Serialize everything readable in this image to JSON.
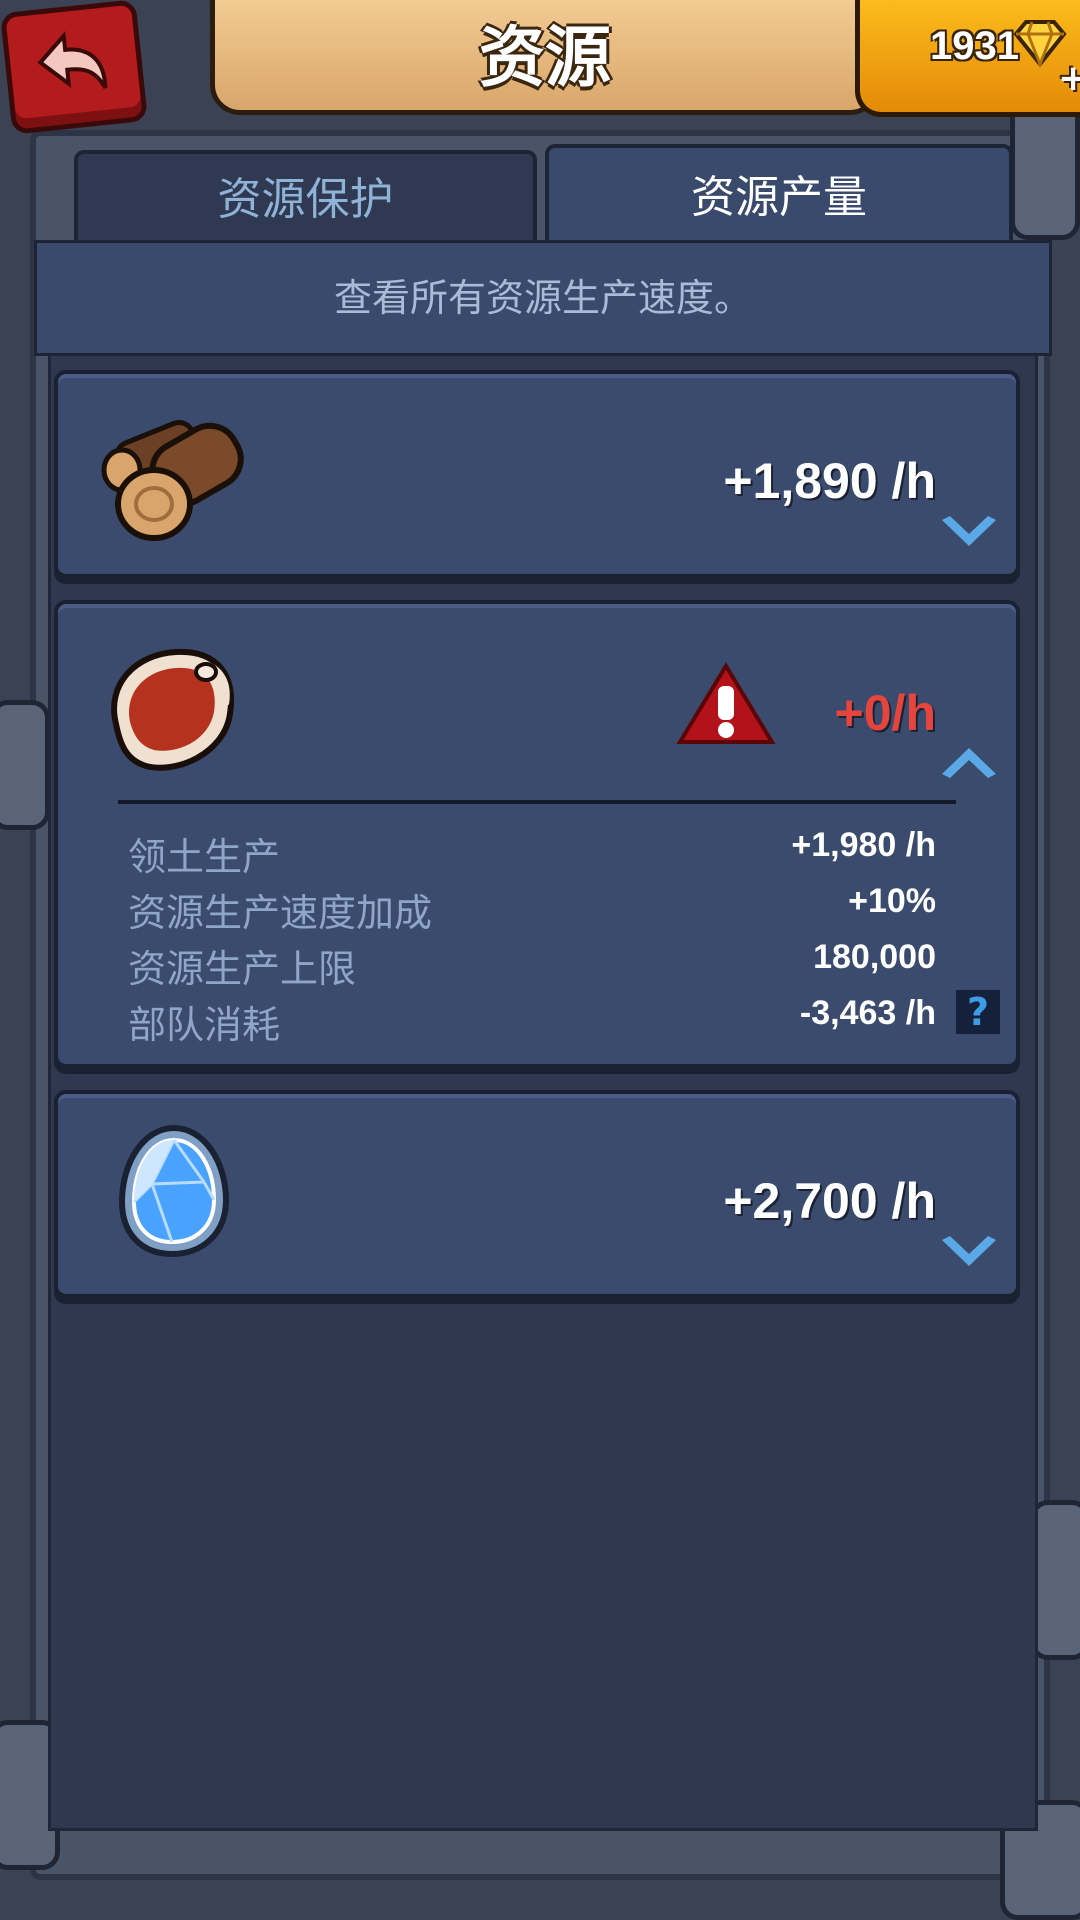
{
  "header": {
    "title": "资源",
    "gems": "1931"
  },
  "tabs": [
    {
      "label": "资源保护",
      "active": false
    },
    {
      "label": "资源产量",
      "active": true
    }
  ],
  "description": "查看所有资源生产速度。",
  "resources": {
    "wood": {
      "icon": "wood-logs-icon",
      "rate": "+1,890 /h",
      "expanded": false
    },
    "food": {
      "icon": "meat-icon",
      "rate": "+0/h",
      "warning": true,
      "expanded": true,
      "details": [
        {
          "label": "领土生产",
          "value": "+1,980 /h"
        },
        {
          "label": "资源生产速度加成",
          "value": "+10%"
        },
        {
          "label": "资源生产上限",
          "value": "180,000"
        },
        {
          "label": "部队消耗",
          "value": "-3,463 /h"
        }
      ],
      "help": "?"
    },
    "stone": {
      "icon": "crystal-icon",
      "rate": "+2,700 /h",
      "expanded": false
    }
  },
  "colors": {
    "accent_blue": "#5aa9e6",
    "warning_red": "#e5453c",
    "gold": "#f4a51c"
  }
}
